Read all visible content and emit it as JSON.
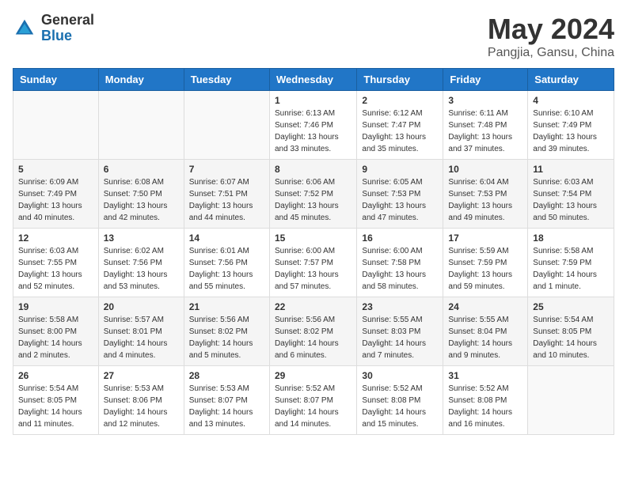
{
  "logo": {
    "general": "General",
    "blue": "Blue"
  },
  "title": "May 2024",
  "location": "Pangjia, Gansu, China",
  "weekdays": [
    "Sunday",
    "Monday",
    "Tuesday",
    "Wednesday",
    "Thursday",
    "Friday",
    "Saturday"
  ],
  "weeks": [
    [
      {
        "day": "",
        "info": ""
      },
      {
        "day": "",
        "info": ""
      },
      {
        "day": "",
        "info": ""
      },
      {
        "day": "1",
        "info": "Sunrise: 6:13 AM\nSunset: 7:46 PM\nDaylight: 13 hours\nand 33 minutes."
      },
      {
        "day": "2",
        "info": "Sunrise: 6:12 AM\nSunset: 7:47 PM\nDaylight: 13 hours\nand 35 minutes."
      },
      {
        "day": "3",
        "info": "Sunrise: 6:11 AM\nSunset: 7:48 PM\nDaylight: 13 hours\nand 37 minutes."
      },
      {
        "day": "4",
        "info": "Sunrise: 6:10 AM\nSunset: 7:49 PM\nDaylight: 13 hours\nand 39 minutes."
      }
    ],
    [
      {
        "day": "5",
        "info": "Sunrise: 6:09 AM\nSunset: 7:49 PM\nDaylight: 13 hours\nand 40 minutes."
      },
      {
        "day": "6",
        "info": "Sunrise: 6:08 AM\nSunset: 7:50 PM\nDaylight: 13 hours\nand 42 minutes."
      },
      {
        "day": "7",
        "info": "Sunrise: 6:07 AM\nSunset: 7:51 PM\nDaylight: 13 hours\nand 44 minutes."
      },
      {
        "day": "8",
        "info": "Sunrise: 6:06 AM\nSunset: 7:52 PM\nDaylight: 13 hours\nand 45 minutes."
      },
      {
        "day": "9",
        "info": "Sunrise: 6:05 AM\nSunset: 7:53 PM\nDaylight: 13 hours\nand 47 minutes."
      },
      {
        "day": "10",
        "info": "Sunrise: 6:04 AM\nSunset: 7:53 PM\nDaylight: 13 hours\nand 49 minutes."
      },
      {
        "day": "11",
        "info": "Sunrise: 6:03 AM\nSunset: 7:54 PM\nDaylight: 13 hours\nand 50 minutes."
      }
    ],
    [
      {
        "day": "12",
        "info": "Sunrise: 6:03 AM\nSunset: 7:55 PM\nDaylight: 13 hours\nand 52 minutes."
      },
      {
        "day": "13",
        "info": "Sunrise: 6:02 AM\nSunset: 7:56 PM\nDaylight: 13 hours\nand 53 minutes."
      },
      {
        "day": "14",
        "info": "Sunrise: 6:01 AM\nSunset: 7:56 PM\nDaylight: 13 hours\nand 55 minutes."
      },
      {
        "day": "15",
        "info": "Sunrise: 6:00 AM\nSunset: 7:57 PM\nDaylight: 13 hours\nand 57 minutes."
      },
      {
        "day": "16",
        "info": "Sunrise: 6:00 AM\nSunset: 7:58 PM\nDaylight: 13 hours\nand 58 minutes."
      },
      {
        "day": "17",
        "info": "Sunrise: 5:59 AM\nSunset: 7:59 PM\nDaylight: 13 hours\nand 59 minutes."
      },
      {
        "day": "18",
        "info": "Sunrise: 5:58 AM\nSunset: 7:59 PM\nDaylight: 14 hours\nand 1 minute."
      }
    ],
    [
      {
        "day": "19",
        "info": "Sunrise: 5:58 AM\nSunset: 8:00 PM\nDaylight: 14 hours\nand 2 minutes."
      },
      {
        "day": "20",
        "info": "Sunrise: 5:57 AM\nSunset: 8:01 PM\nDaylight: 14 hours\nand 4 minutes."
      },
      {
        "day": "21",
        "info": "Sunrise: 5:56 AM\nSunset: 8:02 PM\nDaylight: 14 hours\nand 5 minutes."
      },
      {
        "day": "22",
        "info": "Sunrise: 5:56 AM\nSunset: 8:02 PM\nDaylight: 14 hours\nand 6 minutes."
      },
      {
        "day": "23",
        "info": "Sunrise: 5:55 AM\nSunset: 8:03 PM\nDaylight: 14 hours\nand 7 minutes."
      },
      {
        "day": "24",
        "info": "Sunrise: 5:55 AM\nSunset: 8:04 PM\nDaylight: 14 hours\nand 9 minutes."
      },
      {
        "day": "25",
        "info": "Sunrise: 5:54 AM\nSunset: 8:05 PM\nDaylight: 14 hours\nand 10 minutes."
      }
    ],
    [
      {
        "day": "26",
        "info": "Sunrise: 5:54 AM\nSunset: 8:05 PM\nDaylight: 14 hours\nand 11 minutes."
      },
      {
        "day": "27",
        "info": "Sunrise: 5:53 AM\nSunset: 8:06 PM\nDaylight: 14 hours\nand 12 minutes."
      },
      {
        "day": "28",
        "info": "Sunrise: 5:53 AM\nSunset: 8:07 PM\nDaylight: 14 hours\nand 13 minutes."
      },
      {
        "day": "29",
        "info": "Sunrise: 5:52 AM\nSunset: 8:07 PM\nDaylight: 14 hours\nand 14 minutes."
      },
      {
        "day": "30",
        "info": "Sunrise: 5:52 AM\nSunset: 8:08 PM\nDaylight: 14 hours\nand 15 minutes."
      },
      {
        "day": "31",
        "info": "Sunrise: 5:52 AM\nSunset: 8:08 PM\nDaylight: 14 hours\nand 16 minutes."
      },
      {
        "day": "",
        "info": ""
      }
    ]
  ]
}
